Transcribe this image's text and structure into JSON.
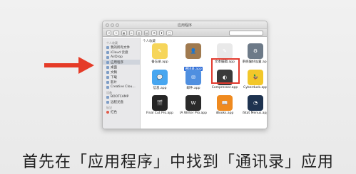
{
  "window": {
    "title": "应用程序",
    "toolbar": [
      "<",
      ">",
      "▦",
      "≡",
      "▥",
      "▤",
      "⚙",
      "⬆",
      "◯"
    ],
    "section_label": "个人收藏"
  },
  "sidebar": {
    "groups": [
      {
        "header": "个人收藏",
        "items": [
          {
            "label": "我的所有文件",
            "selected": false
          },
          {
            "label": "iCloud 云盘",
            "selected": false
          },
          {
            "label": "AirDrop",
            "selected": false
          },
          {
            "label": "应用程序",
            "selected": true
          },
          {
            "label": "桌面",
            "selected": false
          },
          {
            "label": "文稿",
            "selected": false
          },
          {
            "label": "下载",
            "selected": false
          },
          {
            "label": "影片",
            "selected": false
          },
          {
            "label": "Creative Clou…",
            "selected": false
          }
        ]
      },
      {
        "header": "设备",
        "items": [
          {
            "label": "BOOTCAMP",
            "selected": false
          },
          {
            "label": "远程光盘",
            "selected": false
          }
        ]
      },
      {
        "header": "标记",
        "items": [
          {
            "label": "红色",
            "selected": false
          }
        ]
      }
    ]
  },
  "apps": [
    {
      "label": "备忘录.app",
      "color": "#f6d55a",
      "icon": "notes-icon",
      "glyph": "✎",
      "selected": false
    },
    {
      "label": "通讯录.app",
      "color": "#a07a4f",
      "icon": "contacts-icon",
      "glyph": "👤",
      "selected": true
    },
    {
      "label": "文本编辑.app",
      "color": "#e9e9e9",
      "icon": "textedit-icon",
      "glyph": "✎",
      "selected": false
    },
    {
      "label": "系统偏好设置.app",
      "color": "#6d7a88",
      "icon": "system-prefs-icon",
      "glyph": "⚙",
      "selected": false
    },
    {
      "label": "信息.app",
      "color": "#47a6f0",
      "icon": "messages-icon",
      "glyph": "💬",
      "selected": false
    },
    {
      "label": "邮件.app",
      "color": "#4f8fe0",
      "icon": "mail-icon",
      "glyph": "✉",
      "selected": false
    },
    {
      "label": "Compressor.app",
      "color": "#3a3a3a",
      "icon": "compressor-icon",
      "glyph": "◐",
      "selected": false
    },
    {
      "label": "Cyberduck.app",
      "color": "#f2c72a",
      "icon": "cyberduck-icon",
      "glyph": "🦆",
      "selected": false
    },
    {
      "label": "Final Cut Pro.app",
      "color": "#262626",
      "icon": "finalcut-icon",
      "glyph": "🎬",
      "selected": false
    },
    {
      "label": "IA Writer Pro.app",
      "color": "#2a2a2a",
      "icon": "iawriter-icon",
      "glyph": "W",
      "selected": false
    },
    {
      "label": "iBooks.app",
      "color": "#ef8a1f",
      "icon": "ibooks-icon",
      "glyph": "📖",
      "selected": false
    },
    {
      "label": "iStat Menus.app",
      "color": "#1e3350",
      "icon": "istat-icon",
      "glyph": "◔",
      "selected": false
    }
  ],
  "annotation": {
    "arrow_color": "#e53b27",
    "highlight_color": "#e23a2e"
  },
  "caption": "首先在「应用程序」中找到「通讯录」应用"
}
